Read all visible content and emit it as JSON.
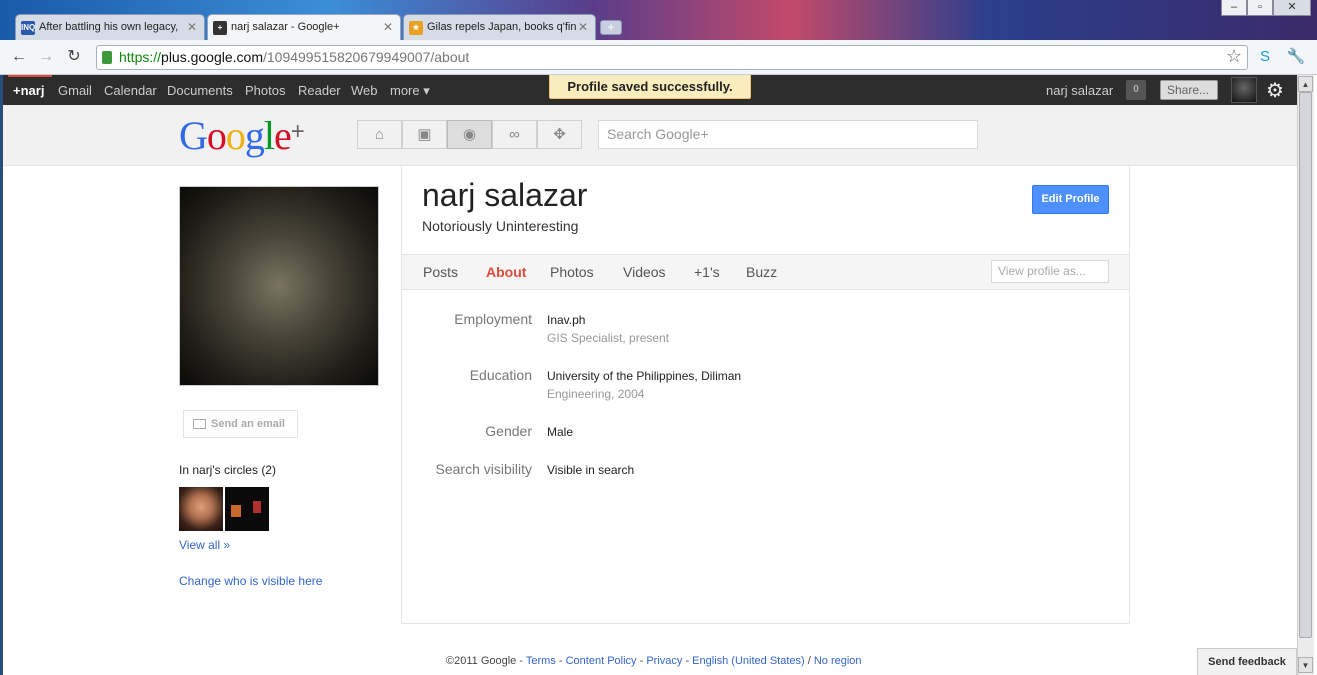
{
  "browser": {
    "tabs": [
      {
        "title": "After battling his own legacy, ",
        "favicon": "INQ",
        "active": false
      },
      {
        "title": "narj salazar - Google+",
        "favicon": "+",
        "active": true
      },
      {
        "title": "Gilas repels Japan, books q'fin",
        "favicon": "★",
        "active": false
      }
    ],
    "url_scheme": "https://",
    "url_host": "plus.google.com",
    "url_path": "/109499515820679949007/about"
  },
  "gbar": {
    "links": [
      "+narj",
      "Gmail",
      "Calendar",
      "Documents",
      "Photos",
      "Reader",
      "Web",
      "more ▾"
    ],
    "user_name": "narj salazar",
    "notification_count": "0",
    "share_label": "Share..."
  },
  "toast": "Profile saved successfully.",
  "header": {
    "search_placeholder": "Search Google+"
  },
  "profile": {
    "name": "narj salazar",
    "tagline": "Notoriously Uninteresting",
    "edit_label": "Edit Profile",
    "tabs": [
      "Posts",
      "About",
      "Photos",
      "Videos",
      "+1's",
      "Buzz"
    ],
    "active_tab": "About",
    "view_as_placeholder": "View profile as...",
    "fields": [
      {
        "label": "Employment",
        "value": "Inav.ph",
        "sub": "GIS Specialist, present"
      },
      {
        "label": "Education",
        "value": "University of the Philippines, Diliman",
        "sub": "Engineering, 2004"
      },
      {
        "label": "Gender",
        "value": "Male",
        "sub": ""
      },
      {
        "label": "Search visibility",
        "value": "Visible in search",
        "sub": ""
      }
    ]
  },
  "sidebar": {
    "send_email": "Send an email",
    "circles_title": "In narj's circles (2)",
    "view_all": "View all »",
    "change_visible": "Change who is visible here"
  },
  "footer": {
    "copyright": "©2011 Google",
    "links": [
      "Terms",
      "Content Policy",
      "Privacy",
      "English (United States)",
      "No region"
    ]
  },
  "feedback_label": "Send feedback"
}
